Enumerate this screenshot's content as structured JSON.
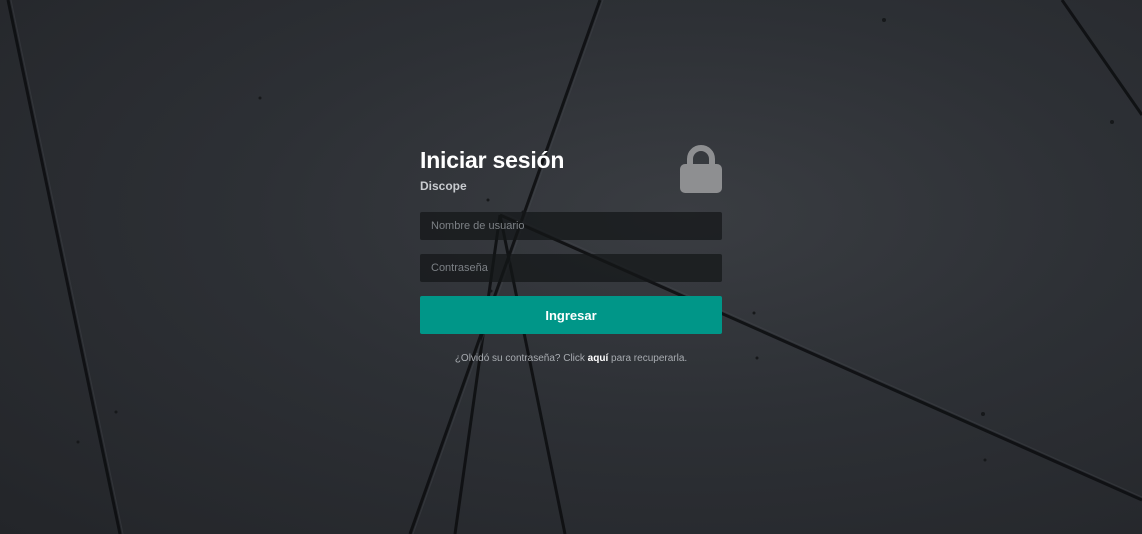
{
  "login": {
    "title": "Iniciar sesión",
    "subtitle": "Discope",
    "lock_icon": "lock-icon",
    "username_placeholder": "Nombre de usuario",
    "password_placeholder": "Contraseña",
    "submit_label": "Ingresar",
    "forgot_prefix": "¿Olvidó su contraseña? Click ",
    "forgot_link": "aquí",
    "forgot_suffix": " para recuperarla."
  },
  "colors": {
    "accent": "#009688",
    "background": "#2d3035",
    "input_background": "#18191b",
    "lock": "#8e8f91"
  }
}
